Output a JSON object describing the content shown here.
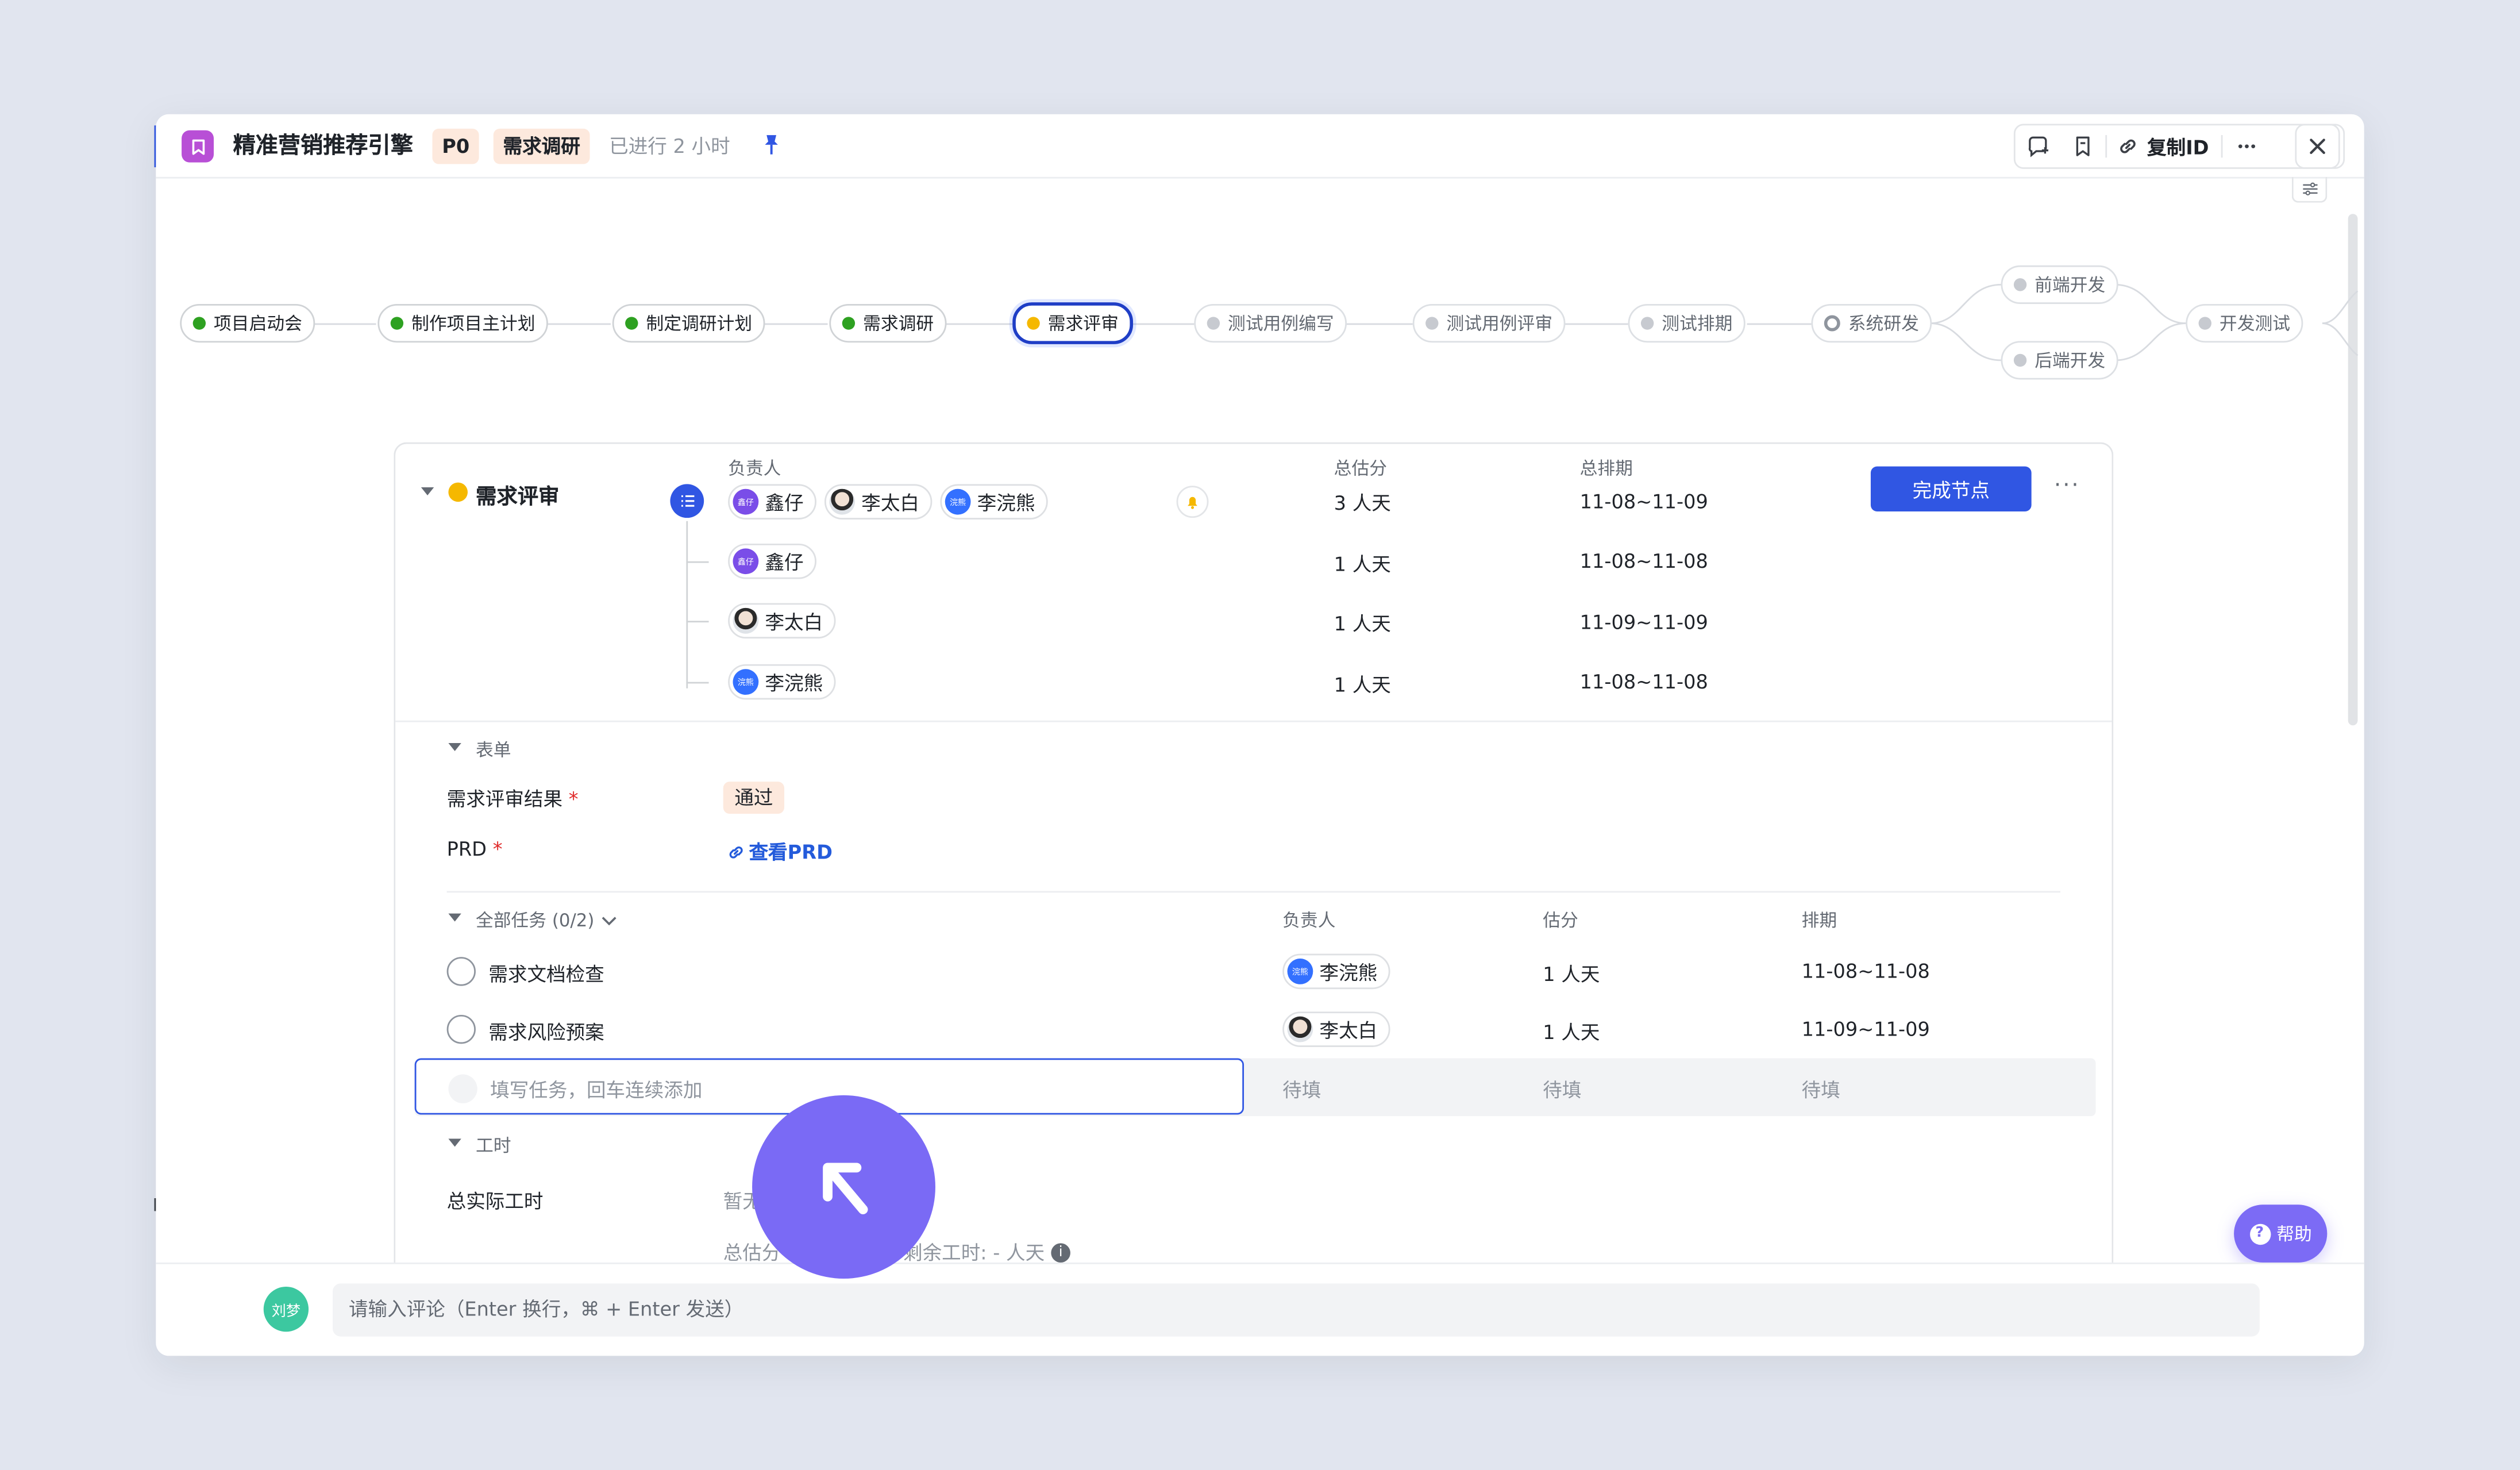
{
  "header": {
    "title": "精准营销推荐引擎",
    "priority": "P0",
    "stage": "需求调研",
    "elapsed": "已进行 2 小时",
    "copy_id_label": "复制ID"
  },
  "pipeline": {
    "nodes": [
      {
        "label": "项目启动会",
        "status": "done"
      },
      {
        "label": "制作项目主计划",
        "status": "done"
      },
      {
        "label": "制定调研计划",
        "status": "done"
      },
      {
        "label": "需求调研",
        "status": "done"
      },
      {
        "label": "需求评审",
        "status": "active"
      },
      {
        "label": "测试用例编写",
        "status": "todo"
      },
      {
        "label": "测试用例评审",
        "status": "todo"
      },
      {
        "label": "测试排期",
        "status": "todo"
      },
      {
        "label": "系统研发",
        "status": "in-progress"
      },
      {
        "label": "前端开发",
        "status": "todo"
      },
      {
        "label": "后端开发",
        "status": "todo"
      },
      {
        "label": "开发测试",
        "status": "todo"
      }
    ]
  },
  "node_card": {
    "name": "需求评审",
    "col_owner": "负责人",
    "col_estimate": "总估分",
    "col_schedule": "总排期",
    "owners": [
      {
        "avatar_text": "鑫仔",
        "name": "鑫仔"
      },
      {
        "avatar_text": "",
        "name": "李太白"
      },
      {
        "avatar_text": "浣熊",
        "name": "李浣熊"
      }
    ],
    "total_estimate": "3 人天",
    "total_schedule": "11-08~11-09",
    "complete_button": "完成节点",
    "rows": [
      {
        "avatar_text": "鑫仔",
        "name": "鑫仔",
        "estimate": "1 人天",
        "schedule": "11-08~11-08"
      },
      {
        "avatar_text": "",
        "name": "李太白",
        "estimate": "1 人天",
        "schedule": "11-09~11-09"
      },
      {
        "avatar_text": "浣熊",
        "name": "李浣熊",
        "estimate": "1 人天",
        "schedule": "11-08~11-08"
      }
    ]
  },
  "form": {
    "section_title": "表单",
    "review_result_label": "需求评审结果",
    "review_result_value": "通过",
    "prd_label": "PRD",
    "prd_link": "查看PRD",
    "required_mark": "*"
  },
  "tasks": {
    "section_title": "全部任务 (0/2)",
    "col_owner": "负责人",
    "col_estimate": "估分",
    "col_schedule": "排期",
    "items": [
      {
        "title": "需求文档检查",
        "owner_avatar": "浣熊",
        "owner": "李浣熊",
        "estimate": "1 人天",
        "schedule": "11-08~11-08"
      },
      {
        "title": "需求风险预案",
        "owner_avatar": "",
        "owner": "李太白",
        "estimate": "1 人天",
        "schedule": "11-09~11-09"
      }
    ],
    "new_task_placeholder": "填写任务，回车连续添加",
    "pending": "待填"
  },
  "worktime": {
    "section_title": "工时",
    "actual_label": "总实际工时",
    "actual_value_partial": "暂无",
    "estimate_partial": "总估分",
    "remaining": "剩余工时: - 人天"
  },
  "comment": {
    "avatar_text": "刘梦",
    "placeholder": "请输入评论（Enter 换行，⌘ + Enter 发送）"
  },
  "help_label": "帮助",
  "colors": {
    "primary": "#3056e3",
    "done": "#2ea121",
    "active": "#f5b800",
    "brand_icon": "#b84fd6",
    "cursor": "#7a6af5"
  }
}
